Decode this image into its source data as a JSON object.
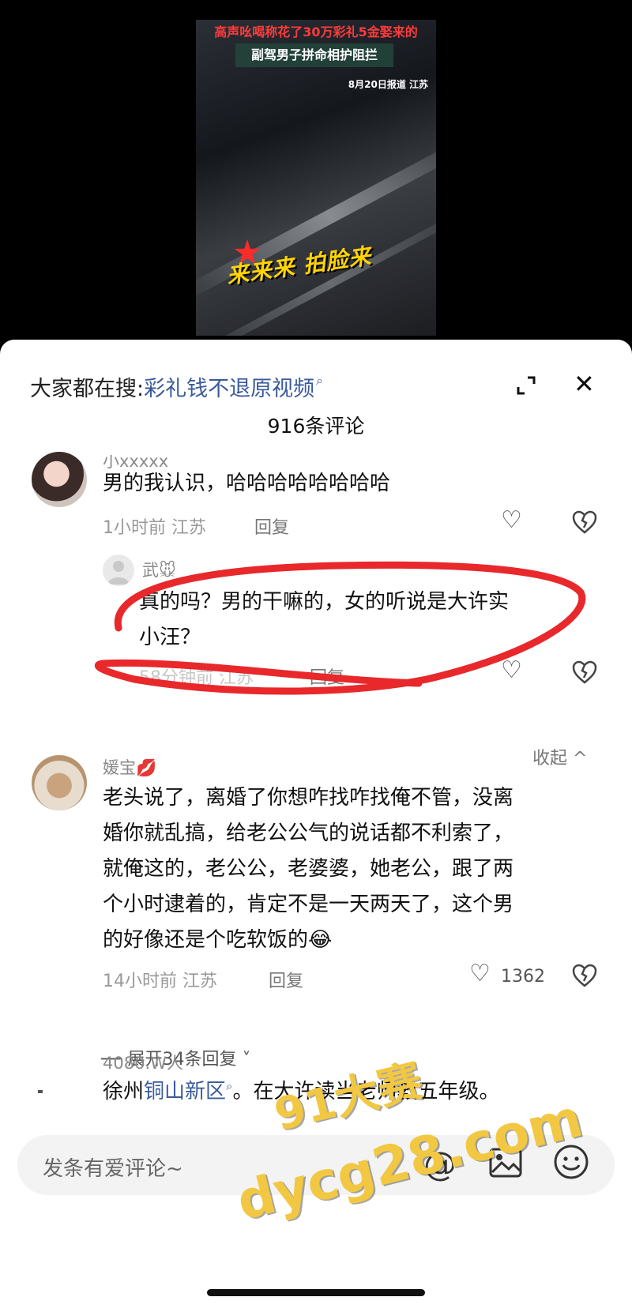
{
  "video": {
    "caption_top": "高声吆喝称花了30万彩礼5金娶来的",
    "caption_mid": "副驾男子拼命相护阻拦",
    "caption_date": "8月20日报道 江苏",
    "caption_bottom": "来来来  拍脸来"
  },
  "sheet": {
    "search_prefix": "大家都在搜:",
    "search_link": "彩礼钱不退原视频",
    "comment_count": "916条评论"
  },
  "comments": [
    {
      "name": "小xxxxx",
      "text": "男的我认识，哈哈哈哈哈哈哈哈",
      "meta": "1小时前 江苏",
      "reply_label": "回复"
    },
    {
      "name": "武🐭",
      "text_line1": "真的吗？男的干嘛的，女的听说是大许实",
      "text_line2": "小汪？",
      "meta": "58分钟前 江苏",
      "reply_label": "回复"
    },
    {
      "name": "媛宝💋",
      "lines": [
        "老头说了，离婚了你想咋找咋找俺不管，没离",
        "婚你就乱搞，给老公公气的说话都不利索了，",
        "就俺这的，老公公，老婆婆，她老公，跟了两",
        "个小时逮着的，肯定不是一天两天了，这个男",
        "的好像还是个吃软饭的😂"
      ],
      "meta": "14小时前 江苏",
      "reply_label": "回复",
      "likes": "1362"
    },
    {
      "name": "4080.W人",
      "text_prefix": "徐州",
      "text_link": "铜山新区",
      "text_suffix": "。在大许读当老师教五年级。"
    }
  ],
  "collapse_label": "收起 ^",
  "expand_replies": "── 展开34条回复 ˅",
  "input": {
    "placeholder": "发条有爱评论~"
  },
  "watermark": {
    "line1": "91大赛",
    "line2": "dycg28.com"
  },
  "colors": {
    "link": "#3a5a9a",
    "annotation": "#e8282b",
    "watermark": "#f2c843"
  }
}
